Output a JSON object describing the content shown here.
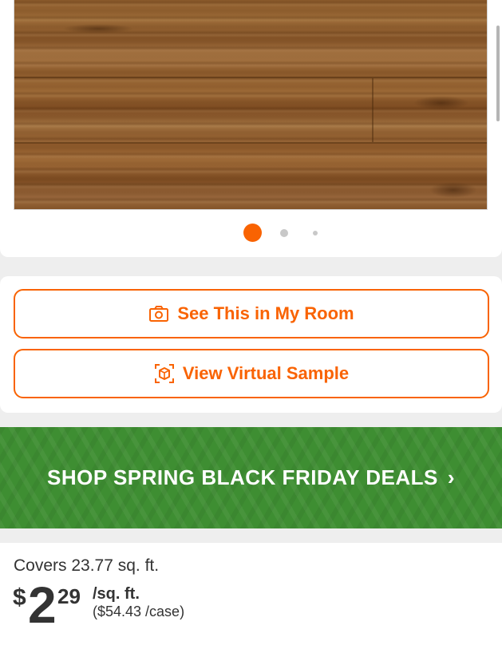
{
  "carousel": {
    "total_slides": 3,
    "active_index": 0,
    "active_color": "#f96302",
    "inactive_color": "#c8c8c8"
  },
  "actions": {
    "see_in_room_label": "See This in My Room",
    "see_in_room_icon": "camera-icon",
    "virtual_sample_label": "View Virtual Sample",
    "virtual_sample_icon": "ar-cube-icon",
    "accent_color": "#f96302"
  },
  "promo": {
    "text": "SHOP SPRING BLACK FRIDAY DEALS",
    "chevron": "›",
    "background_color": "#3e8e32"
  },
  "pricing": {
    "coverage": "Covers 23.77 sq. ft.",
    "currency_symbol": "$",
    "price_whole": "2",
    "price_cents": "29",
    "unit": "/sq. ft.",
    "case_price": "($54.43 /case)"
  }
}
